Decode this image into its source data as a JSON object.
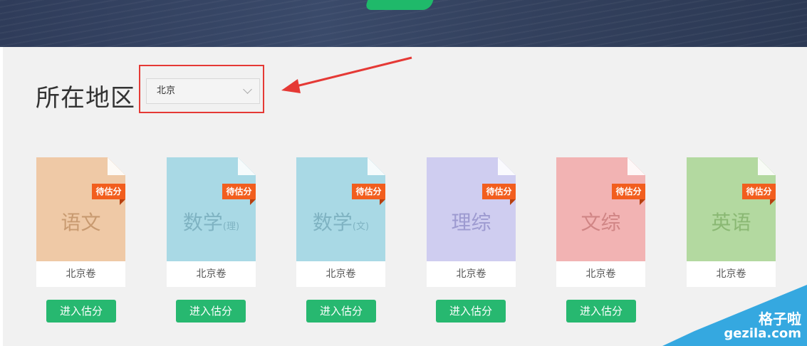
{
  "region": {
    "label": "所在地区",
    "selected": "北京"
  },
  "tag_text": "待估分",
  "button_label": "进入估分",
  "subjects": [
    {
      "name": "语文",
      "suffix": "",
      "paper": "北京卷",
      "color": "#efc9a6",
      "subject_color": "#c89a70"
    },
    {
      "name": "数学",
      "suffix": "(理)",
      "paper": "北京卷",
      "color": "#a9d9e5",
      "subject_color": "#7fb3c2"
    },
    {
      "name": "数学",
      "suffix": "(文)",
      "paper": "北京卷",
      "color": "#a9d9e5",
      "subject_color": "#7fb3c2"
    },
    {
      "name": "理综",
      "suffix": "",
      "paper": "北京卷",
      "color": "#cfcdf0",
      "subject_color": "#9d9ad0"
    },
    {
      "name": "文综",
      "suffix": "",
      "paper": "北京卷",
      "color": "#f2b3b3",
      "subject_color": "#d08585"
    },
    {
      "name": "英语",
      "suffix": "",
      "paper": "北京卷",
      "color": "#b3d9a0",
      "subject_color": "#8ab873"
    }
  ],
  "watermark": {
    "name": "格子啦",
    "url": "gezila.com"
  }
}
